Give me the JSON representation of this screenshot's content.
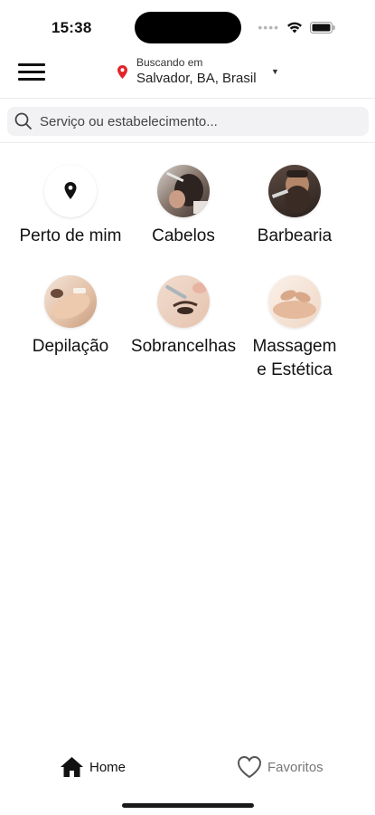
{
  "status_bar": {
    "time": "15:38",
    "carrier_dots": "•••• "
  },
  "header": {
    "menu_icon": "hamburger-icon",
    "location_label": "Buscando em",
    "location_value": "Salvador, BA, Brasil",
    "location_icon": "map-pin-icon",
    "accent_color": "#e0262b"
  },
  "search": {
    "placeholder": "Serviço ou estabelecimento..."
  },
  "categories": [
    {
      "label": "Perto de mim",
      "icon": "location-pin-icon"
    },
    {
      "label": "Cabelos",
      "icon": "haircut-photo"
    },
    {
      "label": "Barbearia",
      "icon": "barber-photo"
    },
    {
      "label": "Depilação",
      "icon": "waxing-photo"
    },
    {
      "label": "Sobrancelhas",
      "icon": "eyebrow-photo"
    },
    {
      "label": "Massagem\ne Estética",
      "icon": "massage-photo"
    }
  ],
  "tabbar": {
    "home_label": "Home",
    "favorites_label": "Favoritos",
    "home_icon": "home-icon",
    "favorites_icon": "heart-icon"
  }
}
